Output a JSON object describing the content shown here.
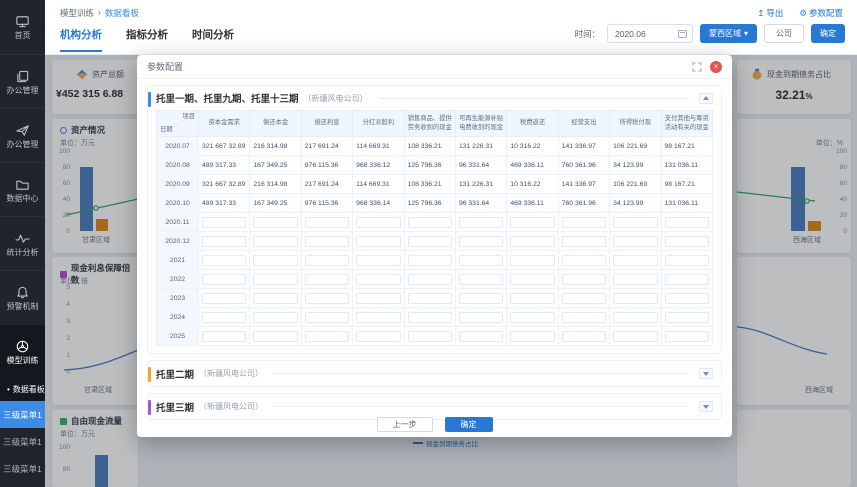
{
  "colors": {
    "primary": "#2878d4",
    "accent_blue": "#3d8ce4",
    "accent_orange": "#f5a623",
    "accent_purple": "#a05ad5",
    "bar_blue": "#4f7fbe",
    "bar_orange": "#df8a18",
    "line_green": "#2fa86f",
    "line_blue": "#4a7ec0",
    "close_red": "#e35350"
  },
  "icons": {
    "caret_down": "▾",
    "export": "↥",
    "gear": "⚙",
    "close": "×",
    "bullet": "•"
  },
  "sidebar": {
    "items": [
      {
        "label": "首页",
        "icon": "monitor-icon",
        "active": false
      },
      {
        "label": "办公管理",
        "icon": "copy-icon",
        "active": false
      },
      {
        "label": "办公管理",
        "icon": "send-icon",
        "active": false
      },
      {
        "label": "数据中心",
        "icon": "folder-icon",
        "active": false
      },
      {
        "label": "统计分析",
        "icon": "pulse-icon",
        "active": false
      },
      {
        "label": "预警机制",
        "icon": "bell-icon",
        "active": false
      },
      {
        "label": "模型训练",
        "icon": "model-icon",
        "active": true
      }
    ],
    "active_sub": "数据看板",
    "third_menus": [
      {
        "label": "三级菜单1",
        "active": true
      },
      {
        "label": "三级菜单1",
        "active": false
      },
      {
        "label": "三级菜单1",
        "active": false
      }
    ]
  },
  "breadcrumb": {
    "parent": "模型训练",
    "separator": "›",
    "current": "数据看板"
  },
  "header_links": {
    "export": "导出",
    "param_config": "参数配置"
  },
  "tabs": [
    {
      "label": "机构分析",
      "active": true
    },
    {
      "label": "指标分析",
      "active": false
    },
    {
      "label": "时间分析",
      "active": false
    }
  ],
  "filters": {
    "time_label": "时间：",
    "time_value": "2020.06",
    "region_button": "蒙西区域",
    "company_button": "公司",
    "confirm_button": "确定"
  },
  "stat_left": {
    "title": "资产总额",
    "value": "¥452 315 6.88"
  },
  "stat_right": {
    "title": "现金到期债务占比",
    "value": "32.21",
    "unit": "%"
  },
  "charts": {
    "left_bar": {
      "title": "资产情况",
      "unit": "单位：万元",
      "yticks": [
        "100",
        "80",
        "60",
        "40",
        "20",
        "0"
      ],
      "xlabel": "甘肃区域",
      "bar_blue": 80,
      "bar_orange": 15,
      "line_point": 47
    },
    "left_line": {
      "title": "现金利息保障倍数",
      "unit": "单位：倍",
      "yticks": [
        "5",
        "4",
        "3",
        "2",
        "1",
        "0"
      ],
      "xlabel": "甘肃区域"
    },
    "left_bottom": {
      "title": "自由现金流量",
      "unit": "单位：万元",
      "yticks": [
        "100",
        "80"
      ],
      "bar_blue": 85
    },
    "right_bar": {
      "unit": "单位：%",
      "yticks": [
        "100",
        "80",
        "60",
        "40",
        "20",
        "0"
      ],
      "xlabel": "西海区域",
      "bar_blue": 80,
      "bar_orange": 12,
      "line_point": 18
    },
    "right_line": {
      "xlabel": "西海区域"
    }
  },
  "background_legend": "现金到期债务占比",
  "modal": {
    "title": "参数配置",
    "sections": [
      {
        "title": "托里一期、托里九期、托里十三期",
        "subtitle": "（新疆风电公司）",
        "accent": "#3d8ce4",
        "expanded": true
      },
      {
        "title": "托里二期",
        "subtitle": "（新疆风电公司）",
        "accent": "#f5a623",
        "expanded": false
      },
      {
        "title": "托里三期",
        "subtitle": "（新疆风电公司）",
        "accent": "#a05ad5",
        "expanded": false
      }
    ],
    "table": {
      "corner_top": "项目",
      "corner_bottom": "日期",
      "columns": [
        "资本金需求",
        "偿还本金",
        "偿还利息",
        "分红派股利",
        "销售商品、提供\n劳务收到的现金",
        "可再生能源补贴\n电费收到的现金",
        "税费返还",
        "经营支出",
        "所得税付现",
        "支付其他与筹资\n活动有关的现金"
      ],
      "rows": [
        {
          "date": "2020.07",
          "values": [
            "321 667 32.89",
            "216 314.98",
            "217 691.24",
            "114 669.31",
            "108 336.21",
            "131 226.31",
            "10 316.22",
            "141 336.97",
            "106 221.69",
            "98 167.21"
          ]
        },
        {
          "date": "2020.08",
          "values": [
            "489 317.33",
            "167 349.25",
            "976 115.36",
            "968 336.12",
            "125 796.36",
            "96 331.64",
            "469 336.11",
            "760 361.96",
            "34 123.99",
            "131 036.11"
          ]
        },
        {
          "date": "2020.09",
          "values": [
            "321 667 32.89",
            "216 314.98",
            "217 691.24",
            "114 669.31",
            "108 336.21",
            "131 226.31",
            "10 316.22",
            "141 336.97",
            "106 221.69",
            "98 167.21"
          ]
        },
        {
          "date": "2020.10",
          "values": [
            "489 317.33",
            "167 349.25",
            "976 115.36",
            "968 336.14",
            "125 796.36",
            "96 331.64",
            "469 336.11",
            "760 361.96",
            "34 123.99",
            "131 036.11"
          ]
        },
        {
          "date": "2020.11",
          "values": []
        },
        {
          "date": "2020.12",
          "values": []
        },
        {
          "date": "2021",
          "values": []
        },
        {
          "date": "2022",
          "values": []
        },
        {
          "date": "2023",
          "values": []
        },
        {
          "date": "2024",
          "values": []
        },
        {
          "date": "2025",
          "values": []
        }
      ]
    },
    "footer": {
      "prev": "上一步",
      "confirm": "确定"
    }
  }
}
